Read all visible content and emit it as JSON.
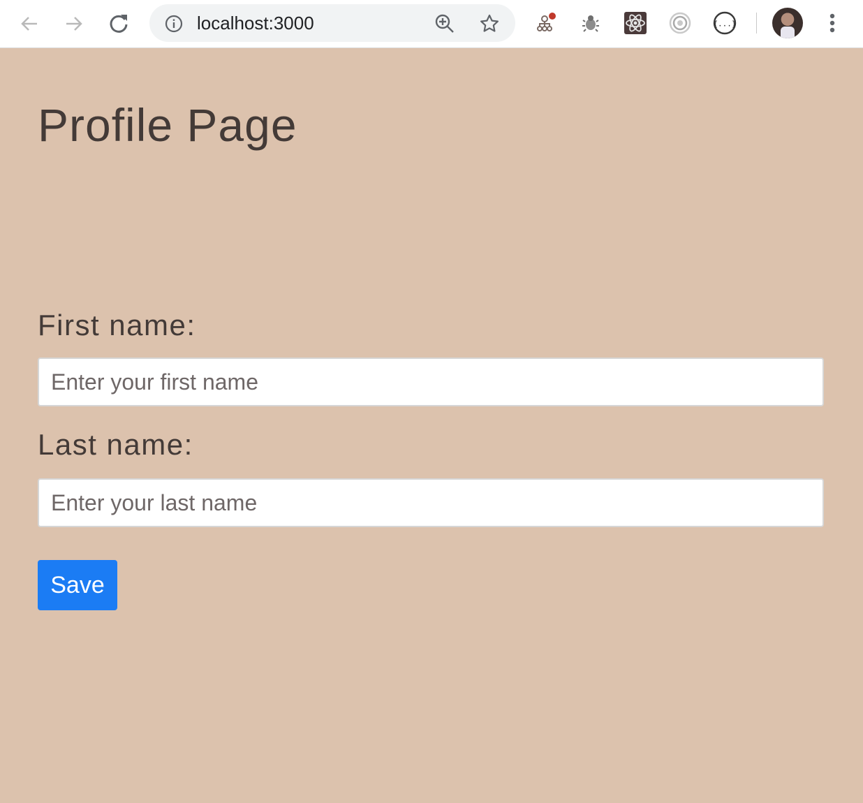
{
  "browser": {
    "url": "localhost:3000",
    "icons": {
      "back": "arrow-left-icon",
      "forward": "arrow-right-icon",
      "reload": "reload-icon",
      "site_info": "info-icon",
      "zoom": "zoom-in-icon",
      "bookmark": "star-icon",
      "menu": "more-vertical-icon"
    },
    "extensions": [
      "extension-graph-icon",
      "extension-bug-icon",
      "extension-react-icon",
      "extension-target-icon",
      "extension-json-icon"
    ]
  },
  "page": {
    "background": "#dcc2ad",
    "title": "Profile Page",
    "form": {
      "first_name_label": "First name:",
      "first_name_placeholder": "Enter your first name",
      "first_name_value": "",
      "last_name_label": "Last name:",
      "last_name_placeholder": "Enter your last name",
      "last_name_value": "",
      "save_label": "Save",
      "save_color": "#1b7cf4"
    }
  }
}
